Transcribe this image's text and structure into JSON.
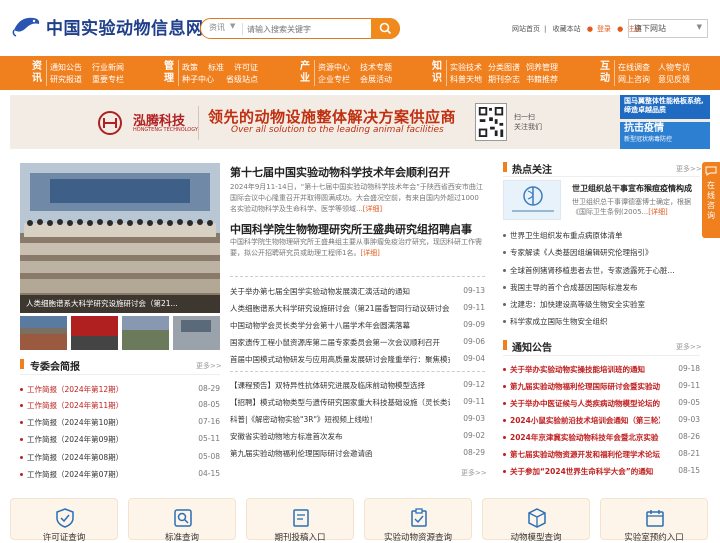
{
  "header": {
    "logo_text": "中国实验动物信息网",
    "search": {
      "category": "资讯",
      "placeholder": "请输入搜索关键字"
    },
    "links": {
      "home": "网站首页",
      "favorite": "收藏本站",
      "login": "登录",
      "register": "注册"
    },
    "site_select": "旗下网站"
  },
  "nav": [
    {
      "title": "资讯",
      "items": [
        "通知公告",
        "行业新闻",
        "研究报道",
        "重要专栏"
      ]
    },
    {
      "title": "管理",
      "items": [
        "政策",
        "标准",
        "许可证",
        "种子中心",
        "省级站点"
      ]
    },
    {
      "title": "产业",
      "items": [
        "资源中心",
        "技术专题",
        "企业专栏",
        "会展活动"
      ]
    },
    {
      "title": "知识",
      "items": [
        "实验技术",
        "分类图谱",
        "饲养管理",
        "科普天地",
        "期刊杂志",
        "书籍推荐"
      ]
    },
    {
      "title": "互动",
      "items": [
        "在线调查",
        "人物专访",
        "网上咨询",
        "意见反馈"
      ]
    }
  ],
  "banner": {
    "company": "泓腾科技",
    "company_en": "HONGTENG TECHNOLOGY",
    "slogan": "领先的动物设施整体解决方案供应商",
    "slogan_en": "Over all solution to the leading animal facilities",
    "scan": [
      "扫一扫",
      "关注我们"
    ],
    "ad1": "国马翼整体性能格板系统,缔造卓越品质",
    "ad2_title": "抗击疫情",
    "ad2_sub": "新型冠状病毒防控"
  },
  "hero": {
    "caption": "人类细胞谱系大科学研究设施研讨会（第21..."
  },
  "headlines": [
    {
      "title": "第十七届中国实验动物科学技术年会顺利召开",
      "summary": "2024年9月11-14日，“第十七届中国实验动物科学技术年会”于陕西省西安市曲江国际会议中心隆重召开并取得圆满成功。大会盛况空前，有来自国内外超过1000名实验动物科学及生命科学、医学等领域...",
      "more": "[详细]"
    },
    {
      "title": "中国科学院生物物理研究所王盛典研究组招聘启事",
      "summary": "中国科学院生物物理研究所王盛典组主要从事肿瘤免疫治疗研究，现因科研工作需要，拟公开招聘研究员或助理工程师1名。",
      "more": "[详细]"
    }
  ],
  "center_list1": [
    {
      "text": "关于举办第七届全国学实验动物发展演汇演活动的通知",
      "date": "09-13"
    },
    {
      "text": "人类细胞谱系大科学研究设施研讨会（第21届香智同行动议研讨会）",
      "date": "09-11"
    },
    {
      "text": "中国动物学会灵长类学分会第十八届学术年会圆满落幕",
      "date": "09-09"
    },
    {
      "text": "国家遗传工程小鼠资源库第二届专家委员会第一次会议顺利召开",
      "date": "09-06"
    },
    {
      "text": "首届中国模式动物研发与应用高质量发展研讨会隆重举行：聚焦模式",
      "date": "09-04"
    }
  ],
  "center_list2": [
    {
      "text": "【课程预告】双特异性抗体研究进展及临床前动物模型选择",
      "date": "09-12"
    },
    {
      "text": "【招聘】模式动物类型与遗传研究国家重大科技基础设施（灵长类设",
      "date": "09-11"
    },
    {
      "text": "科普|《解密动物实验\"3R\"》短视频上线啦！",
      "date": "09-03"
    },
    {
      "text": "安徽省实验动物地方标准首次发布",
      "date": "09-02"
    },
    {
      "text": "第九届实验动物福利伦理国际研讨会邀请函",
      "date": "08-29"
    }
  ],
  "center_more": "更多>>",
  "special": {
    "title": "专委会简报",
    "more": "更多>>",
    "items": [
      {
        "text": "工作简报（2024年第12期）",
        "date": "08-29",
        "red": true
      },
      {
        "text": "工作简报（2024年第11期）",
        "date": "08-05",
        "red": true
      },
      {
        "text": "工作简报（2024年第10期）",
        "date": "07-16",
        "red": false
      },
      {
        "text": "工作简报（2024年第09期）",
        "date": "05-11",
        "red": false
      },
      {
        "text": "工作简报（2024年第08期）",
        "date": "05-08",
        "red": false
      },
      {
        "text": "工作简报（2024年第07期）",
        "date": "04-15",
        "red": false
      }
    ]
  },
  "hot": {
    "title": "热点关注",
    "more": "更多>>",
    "feature_title": "世卫组织总干事宣布猴痘疫情构成",
    "feature_summary": "世卫组织总干事谭德塞博士确定，根据《国际卫生条例(2005...",
    "feature_more": "[详细]",
    "items": [
      "世界卫生组织发布重点病原体清单",
      "专家解读《人类基因组编辑研究伦理指引》",
      "全球首例猪肾移植患者去世，专家透露死于心脏...",
      "我国主导的首个合成基因国际标准发布",
      "沈建忠：加快建设高等级生物安全实验室",
      "科学家成立国际生物安全组织"
    ]
  },
  "notice": {
    "title": "通知公告",
    "more": "更多>>",
    "items": [
      {
        "text": "关于举办实验动物实操技能培训班的通知",
        "date": "09-18"
      },
      {
        "text": "第九届实验动物福利伦理国际研讨会暨实验动",
        "date": "09-11"
      },
      {
        "text": "关于举办中医证候与人类疾病动物模型论坛的",
        "date": "09-05"
      },
      {
        "text": "2024小鼠实验前沿技术培训会通知（第三轮）",
        "date": "09-03"
      },
      {
        "text": "2024年京津冀实验动物科技年会暨北京实验",
        "date": "08-26"
      },
      {
        "text": "第七届实验动物资源开发和福利伦理学术论坛",
        "date": "08-21"
      },
      {
        "text": "关于参加“2024世界生命科学大会”的通知",
        "date": "08-15"
      }
    ]
  },
  "side_tab": "在线咨询",
  "cards": [
    {
      "label": "许可证查询",
      "icon": "shield-check-icon"
    },
    {
      "label": "标准查询",
      "icon": "search-doc-icon"
    },
    {
      "label": "期刊投稿入口",
      "icon": "journal-icon"
    },
    {
      "label": "实验动物资源查询",
      "icon": "clipboard-icon"
    },
    {
      "label": "动物模型查询",
      "icon": "cube-icon"
    },
    {
      "label": "实验室预约入口",
      "icon": "calendar-icon"
    }
  ],
  "colors": {
    "accent": "#f07f1e",
    "brand_blue": "#1f3f8a",
    "red_link": "#c02020"
  }
}
